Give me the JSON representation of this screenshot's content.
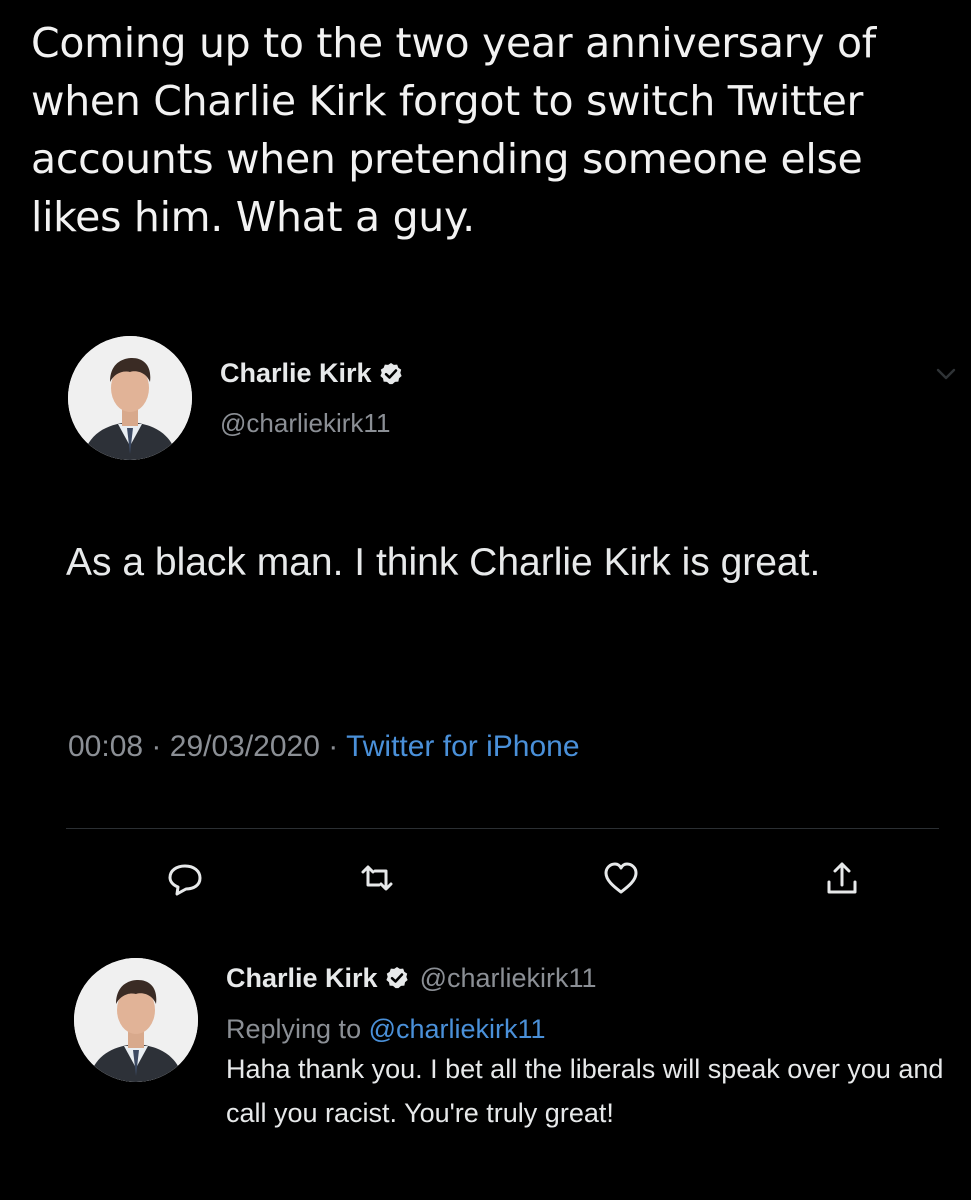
{
  "caption": "Coming up to the two year anniversary of when Charlie Kirk forgot to switch Twitter accounts when pretending someone else likes him. What a guy.",
  "tweet": {
    "author_name": "Charlie Kirk",
    "author_handle": "@charliekirk11",
    "verified_icon": "verified-badge-icon",
    "text": "As a black man. I think Charlie Kirk is great.",
    "time": "00:08",
    "separator": "·",
    "date": "29/03/2020",
    "source": "Twitter for iPhone",
    "actions": [
      "reply-icon",
      "retweet-icon",
      "like-icon",
      "share-icon"
    ]
  },
  "reply": {
    "author_name": "Charlie Kirk",
    "author_handle": "@charliekirk11",
    "replying_label": "Replying to",
    "replying_to": "@charliekirk11",
    "text": "Haha thank you. I bet all the liberals will speak over you and call you racist. You're truly great!"
  },
  "colors": {
    "background": "#000000",
    "text": "#e7e9ea",
    "muted": "#8b8f95",
    "link": "#4a90d9",
    "verified": "#e7e9ea"
  }
}
